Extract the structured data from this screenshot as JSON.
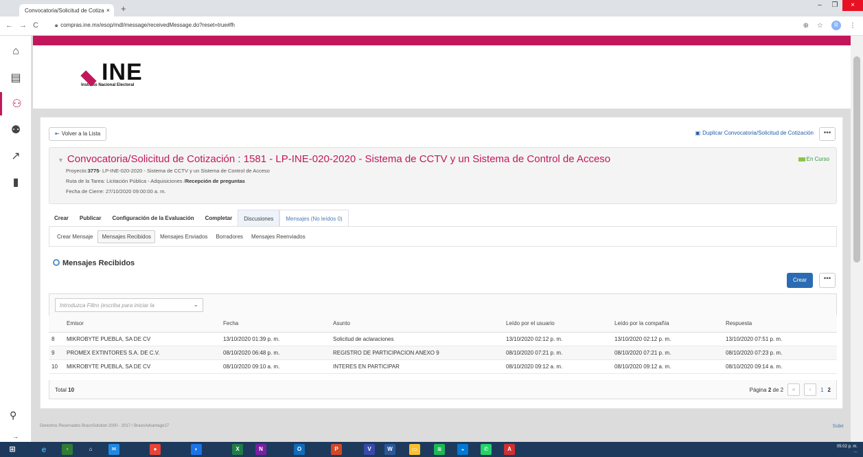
{
  "browser": {
    "tab_title": "Convocatoria/Solicitud de Cotiza",
    "tab_close": "×",
    "new_tab": "+",
    "url": "compras.ine.mx/esop/mdl/message/receivedMessage.do?reset=true#fh",
    "avatar": "R",
    "win_min": "–",
    "win_max": "❐",
    "win_close": "×"
  },
  "logo": {
    "name": "INE",
    "subtitle": "Instituto Nacional Electoral"
  },
  "toolbar": {
    "back_label": "Volver a la Lista",
    "duplicate_label": "Duplicar Convocatoria/Solicitud de Cotización",
    "more_label": "•••"
  },
  "event": {
    "title": "Convocatoria/Solicitud de Cotización : 1581 - LP-INE-020-2020 - Sistema de CCTV y un Sistema de Control de Acceso",
    "status": "En Curso",
    "project_label": "Proyecto:",
    "project_code": "3775",
    "project_rest": "- LP-INE-020-2020 - Sistema de CCTV y un Sistema de Control de Acceso",
    "route_label": "Ruta de la Tarea: Licitación Pública - Adquisiciones /",
    "route_step": "Recepción de preguntas",
    "close_date": "Fecha de Cierre: 27/10/2020 09:00:00 a. m."
  },
  "main_tabs": [
    "Crear",
    "Publicar",
    "Configuración de la Evaluación",
    "Completar",
    "Discusiones",
    "Mensajes (No leídos 0)"
  ],
  "sub_tabs": [
    "Crear Mensaje",
    "Mensajes Recibidos",
    "Mensajes Enviados",
    "Borradores",
    "Mensajes Reenviados"
  ],
  "section_title": "Mensajes Recibidos",
  "create_button": "Crear",
  "filter_placeholder": "Introduzca Filtro (escriba para iniciar la",
  "table": {
    "headers": [
      "",
      "Emisor",
      "Fecha",
      "Asunto",
      "Leído por el usuario",
      "Leído por la compañía",
      "Respuesta"
    ],
    "rows": [
      [
        "8",
        "MIKROBYTE PUEBLA, SA DE CV",
        "13/10/2020 01:39 p. m.",
        "Solicitud de aclaraciones",
        "13/10/2020 02:12 p. m.",
        "13/10/2020 02:12 p. m.",
        "13/10/2020 07:51 p. m."
      ],
      [
        "9",
        "PROMEX EXTINTORES S.A. DE C.V.",
        "08/10/2020 06:48 p. m.",
        "REGISTRO DE PARTICIPACION ANEXO 9",
        "08/10/2020 07:21 p. m.",
        "08/10/2020 07:21 p. m.",
        "08/10/2020 07:23 p. m."
      ],
      [
        "10",
        "MIKROBYTE PUEBLA, SA DE CV",
        "08/10/2020 09:10 a. m.",
        "INTERES EN PARTICIPAR",
        "08/10/2020 09:12 a. m.",
        "08/10/2020 09:12 a. m.",
        "08/10/2020 09:14 a. m."
      ]
    ]
  },
  "footer": {
    "total_label": "Total",
    "total_value": "10",
    "page_label": "Página",
    "page_current": "2",
    "page_of": "de 2",
    "page_links": [
      "1",
      "2"
    ]
  },
  "copyright": "Derechos Reservados BravoSolution 2000 - 2017 / BravoAdvantage17",
  "subir": "Subir",
  "clock": {
    "time": "05:02 p. m.",
    "date": "…"
  },
  "colors": {
    "accent": "#c2185b",
    "primary": "#2a6bb3",
    "status": "#2e9a3a"
  }
}
